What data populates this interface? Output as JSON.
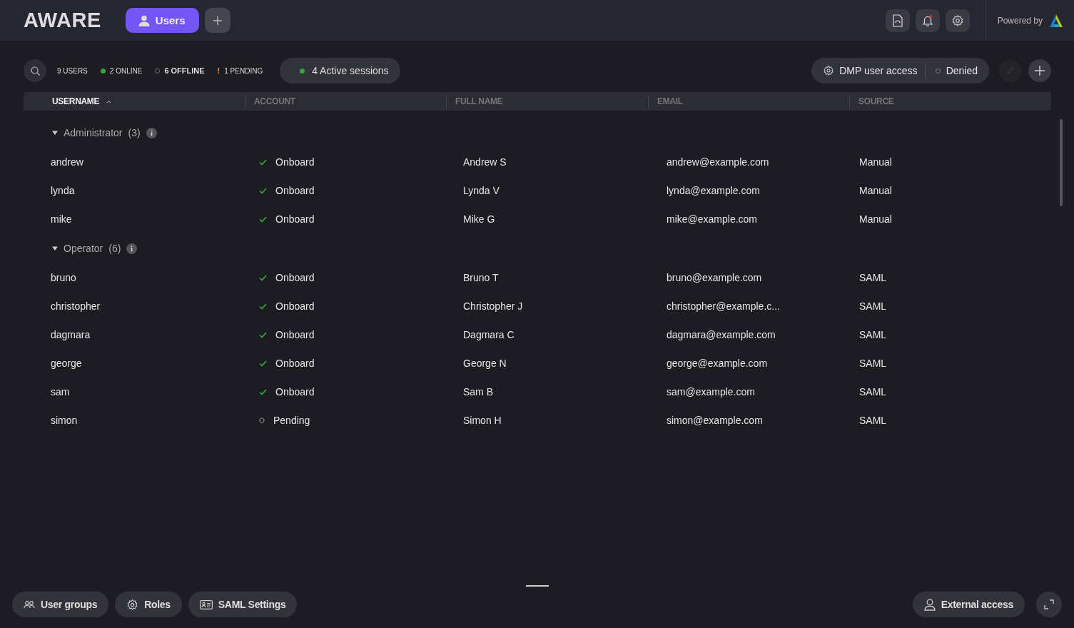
{
  "header": {
    "logo": "AWARE",
    "tabs": [
      {
        "label": "Users",
        "selected": true
      }
    ],
    "powered_by": "Powered by"
  },
  "toolbar": {
    "stats": [
      {
        "label": "9 USERS",
        "kind": "plain",
        "selected": false
      },
      {
        "label": "2 ONLINE",
        "kind": "online",
        "selected": false
      },
      {
        "label": "6 OFFLINE",
        "kind": "offline",
        "selected": true
      },
      {
        "label": "1 PENDING",
        "kind": "pending",
        "mark": "!",
        "selected": false
      }
    ],
    "sessions": "4 Active sessions",
    "dmp_access": {
      "label": "DMP user access",
      "status": "Denied"
    },
    "actions": [
      {
        "kind": "edit",
        "disabled": true
      },
      {
        "kind": "add",
        "disabled": false
      }
    ]
  },
  "table": {
    "columns": [
      {
        "label": "USERNAME",
        "sorted": true
      },
      {
        "label": "ACCOUNT",
        "sorted": false
      },
      {
        "label": "FULL NAME",
        "sorted": false
      },
      {
        "label": "EMAIL",
        "sorted": false
      },
      {
        "label": "SOURCE",
        "sorted": false
      }
    ],
    "groups": [
      {
        "name": "Administrator",
        "count": "(3)",
        "expanded": true,
        "rows": [
          {
            "username": "andrew",
            "account": {
              "label": "Onboard",
              "kind": "onboard"
            },
            "full_name": "Andrew S",
            "email": "andrew@example.com",
            "source": "Manual"
          },
          {
            "username": "lynda",
            "account": {
              "label": "Onboard",
              "kind": "onboard"
            },
            "full_name": "Lynda V",
            "email": "lynda@example.com",
            "source": "Manual"
          },
          {
            "username": "mike",
            "account": {
              "label": "Onboard",
              "kind": "onboard"
            },
            "full_name": "Mike G",
            "email": "mike@example.com",
            "source": "Manual"
          }
        ]
      },
      {
        "name": "Operator",
        "count": "(6)",
        "expanded": true,
        "rows": [
          {
            "username": "bruno",
            "account": {
              "label": "Onboard",
              "kind": "onboard"
            },
            "full_name": "Bruno T",
            "email": "bruno@example.com",
            "source": "SAML"
          },
          {
            "username": "christopher",
            "account": {
              "label": "Onboard",
              "kind": "onboard"
            },
            "full_name": "Christopher J",
            "email": "christopher@example.c...",
            "source": "SAML"
          },
          {
            "username": "dagmara",
            "account": {
              "label": "Onboard",
              "kind": "onboard"
            },
            "full_name": "Dagmara C",
            "email": "dagmara@example.com",
            "source": "SAML"
          },
          {
            "username": "george",
            "account": {
              "label": "Onboard",
              "kind": "onboard"
            },
            "full_name": "George N",
            "email": "george@example.com",
            "source": "SAML"
          },
          {
            "username": "sam",
            "account": {
              "label": "Onboard",
              "kind": "onboard"
            },
            "full_name": "Sam B",
            "email": "sam@example.com",
            "source": "SAML"
          },
          {
            "username": "simon",
            "account": {
              "label": "Pending",
              "kind": "pending"
            },
            "full_name": "Simon H",
            "email": "simon@example.com",
            "source": "SAML"
          }
        ]
      }
    ]
  },
  "footer": {
    "left": [
      {
        "label": "User groups",
        "kind": "groups"
      },
      {
        "label": "Roles",
        "kind": "roles"
      },
      {
        "label": "SAML Settings",
        "kind": "saml"
      }
    ],
    "right": [
      {
        "label": "External access",
        "kind": "person"
      }
    ]
  }
}
